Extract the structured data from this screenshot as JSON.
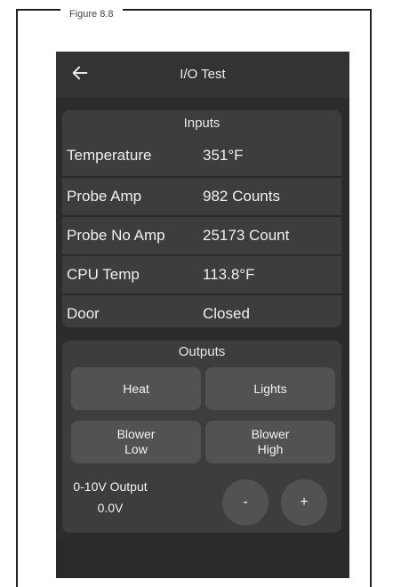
{
  "caption": "Figure 8.8",
  "header": {
    "title": "I/O Test",
    "back_icon": "arrow-left-icon"
  },
  "inputs": {
    "title": "Inputs",
    "rows": [
      {
        "label": "Temperature",
        "value": "351°F"
      },
      {
        "label": "Probe Amp",
        "value": "982 Counts"
      },
      {
        "label": "Probe No Amp",
        "value": "25173 Count"
      },
      {
        "label": "CPU Temp",
        "value": "113.8°F"
      },
      {
        "label": "Door",
        "value": "Closed"
      }
    ]
  },
  "outputs": {
    "title": "Outputs",
    "heat": "Heat",
    "lights": "Lights",
    "blower_low": "Blower\nLow",
    "blower_high": "Blower\nHigh",
    "voltage_label": "0-10V Output",
    "voltage_value": "0.0V",
    "minus": "-",
    "plus": "+"
  },
  "colors": {
    "screen_bg": "#2c2c2c",
    "panel_bg": "#3d3d3d",
    "button_bg": "#525252",
    "text": "#f0f0f0"
  }
}
